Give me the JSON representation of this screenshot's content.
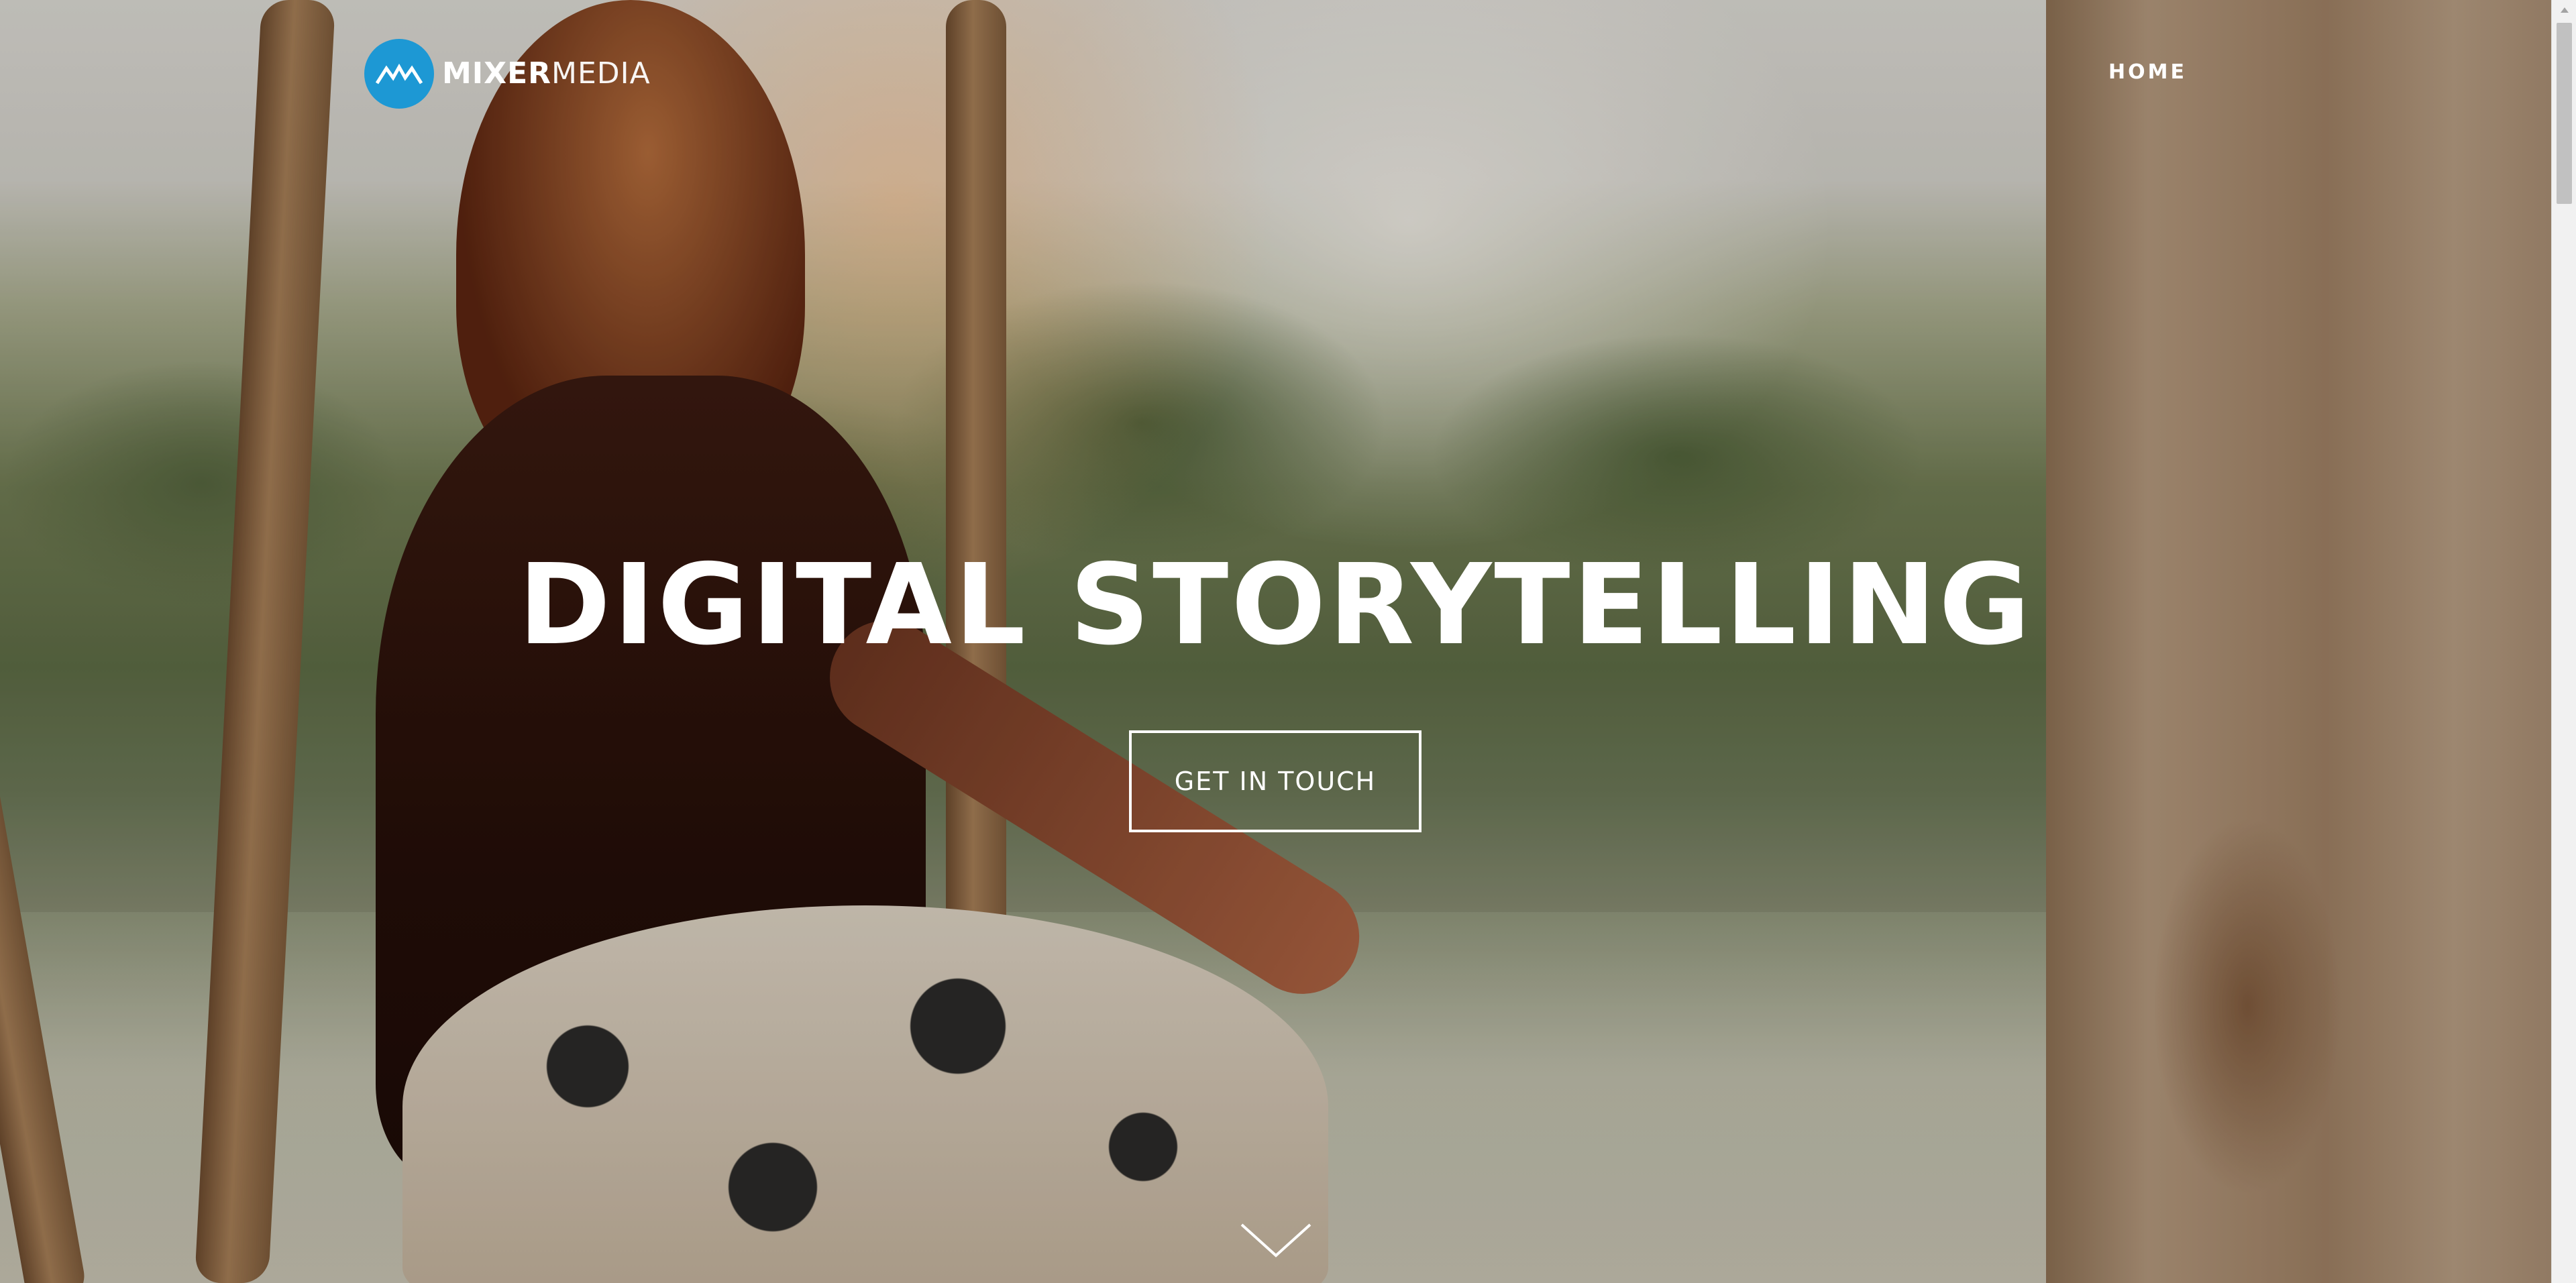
{
  "brand": {
    "name_bold": "MIXER",
    "name_light": "MEDIA",
    "logo_icon": "mountain-m-icon",
    "accent_color": "#1d98d4"
  },
  "nav": {
    "items": [
      {
        "label": "HOME"
      }
    ]
  },
  "hero": {
    "headline": "DIGITAL STORYTELLING",
    "cta_label": "GET IN TOUCH",
    "scroll_icon": "chevron-down-icon"
  }
}
